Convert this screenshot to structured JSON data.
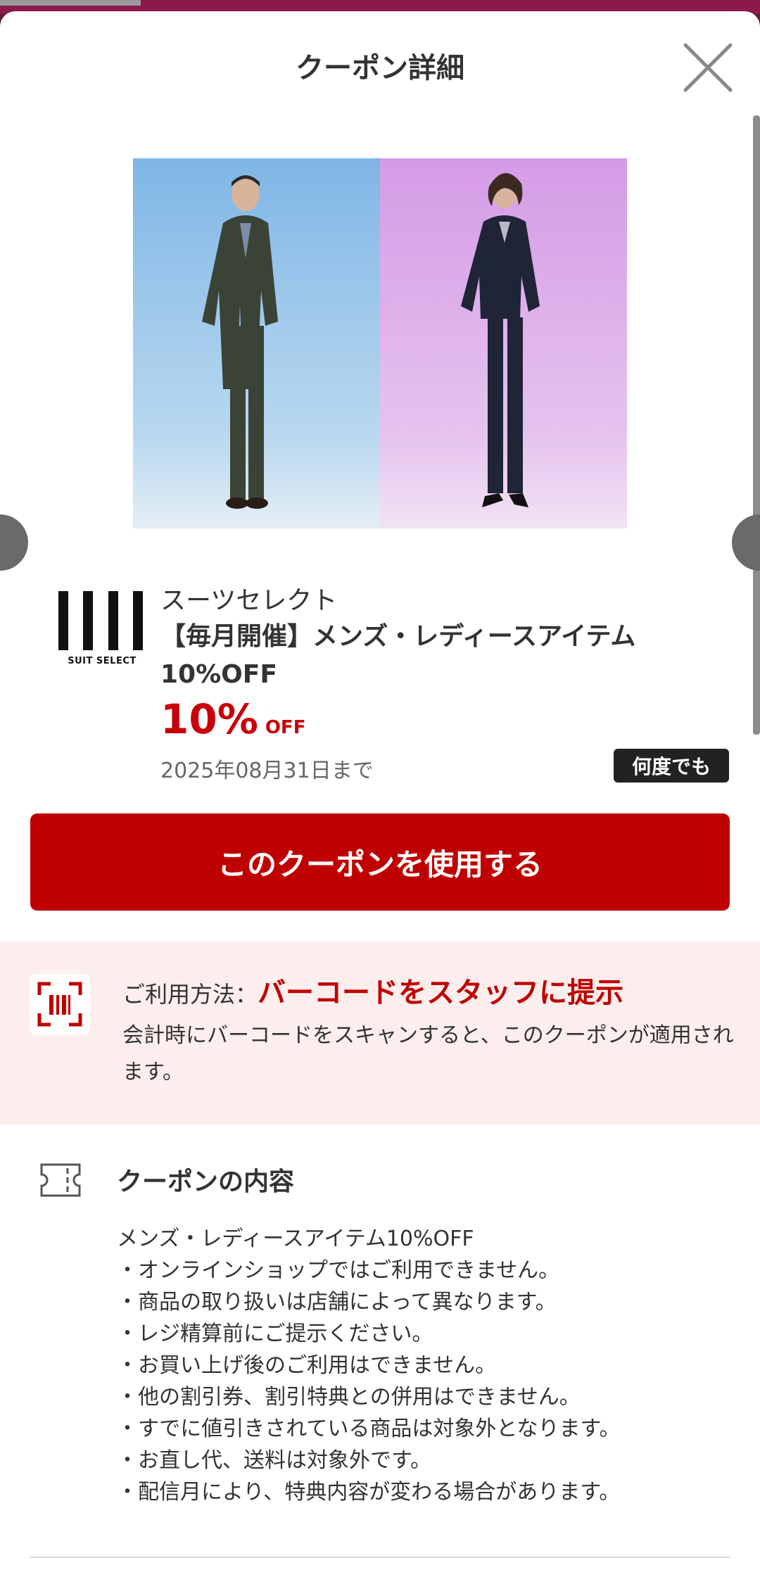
{
  "sheet": {
    "title": "クーポン詳細",
    "close_icon": "close-x-icon"
  },
  "coupon": {
    "store_name": "スーツセレクト",
    "logo_caption": "SUIT SELECT",
    "title": "【毎月開催】メンズ・レディースアイテム10%OFF",
    "discount_value": "10%",
    "discount_unit": "OFF",
    "expiry": "2025年08月31日まで",
    "badge": "何度でも"
  },
  "actions": {
    "use_button": "このクーポンを使用する"
  },
  "howto": {
    "label": "ご利用方法：",
    "method": "バーコードをスタッフに提示",
    "description": "会計時にバーコードをスキャンすると、このクーポンが適用されます。",
    "icon": "barcode-scan-icon"
  },
  "contents": {
    "heading": "クーポンの内容",
    "icon": "ticket-icon",
    "lines": [
      "メンズ・レディースアイテム10%OFF",
      "・オンラインショップではご利用できません。",
      "・商品の取り扱いは店舗によって異なります。",
      "・レジ精算前にご提示ください。",
      "・お買い上げ後のご利用はできません。",
      "・他の割引券、割引特典との併用はできません。",
      "・すでに値引きされている商品は対象外となります。",
      "・お直し代、送料は対象外です。",
      "・配信月により、特典内容が変わる場合があります。"
    ]
  },
  "colors": {
    "accent": "#bf0000",
    "howto_bg": "#fdeeee",
    "badge_bg": "#222222"
  }
}
